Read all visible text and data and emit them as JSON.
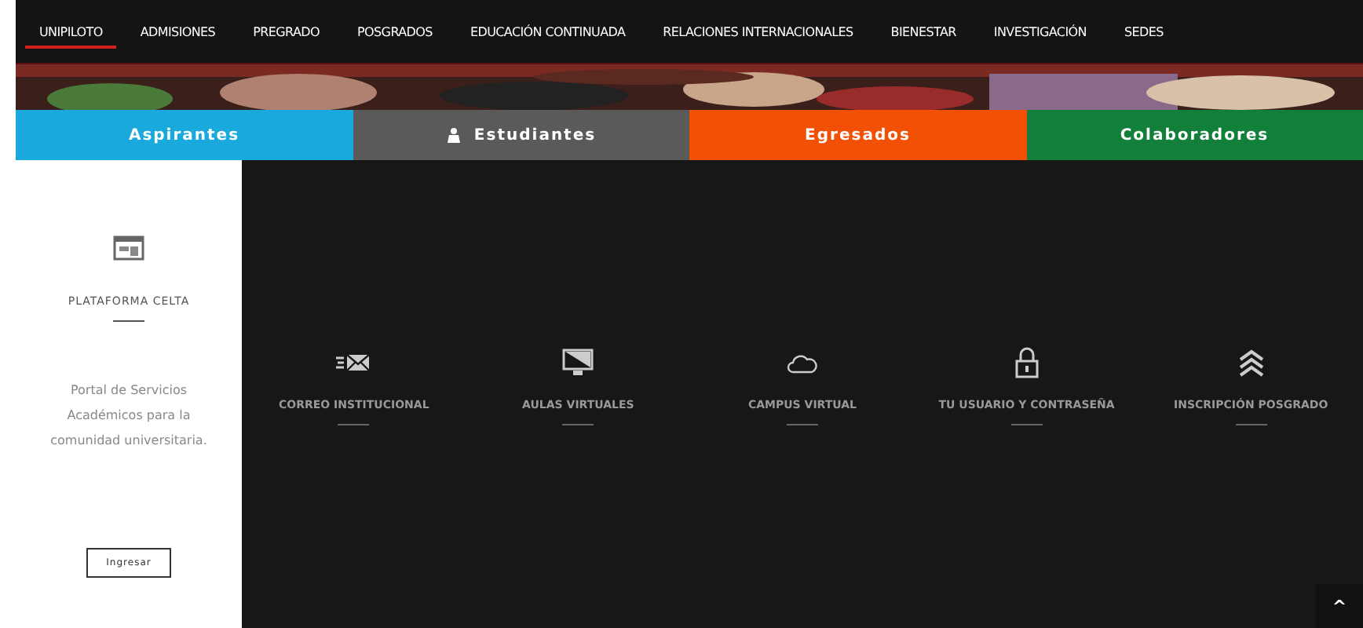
{
  "nav": [
    {
      "label": "UNIPILOTO",
      "selected": true
    },
    {
      "label": "ADMISIONES",
      "selected": false
    },
    {
      "label": "PREGRADO",
      "selected": false
    },
    {
      "label": "POSGRADOS",
      "selected": false
    },
    {
      "label": "EDUCACIÓN CONTINUADA",
      "selected": false
    },
    {
      "label": "RELACIONES INTERNACIONALES",
      "selected": false
    },
    {
      "label": "BIENESTAR",
      "selected": false
    },
    {
      "label": "INVESTIGACIÓN",
      "selected": false
    },
    {
      "label": "SEDES",
      "selected": false
    }
  ],
  "audience_tabs": [
    {
      "label": "Aspirantes",
      "color": "#1aa9dd",
      "icon": false
    },
    {
      "label": "Estudiantes",
      "color": "#5a5a5a",
      "icon": true
    },
    {
      "label": "Egresados",
      "color": "#f25105",
      "icon": false
    },
    {
      "label": "Colaboradores",
      "color": "#12803a",
      "icon": false
    }
  ],
  "platform": {
    "title": "PLATAFORMA CELTA",
    "description": "Portal de Servicios Académicos para la comunidad universitaria.",
    "button": "Ingresar"
  },
  "services": [
    {
      "kind": "mail",
      "label": "CORREO INSTITUCIONAL"
    },
    {
      "kind": "monitor",
      "label": "AULAS VIRTUALES"
    },
    {
      "kind": "cloud",
      "label": "CAMPUS VIRTUAL"
    },
    {
      "kind": "lock",
      "label": "TU USUARIO Y CONTRASEÑA"
    },
    {
      "kind": "chevrons",
      "label": "INSCRIPCIÓN POSGRADO"
    }
  ],
  "scroll_top": "^"
}
